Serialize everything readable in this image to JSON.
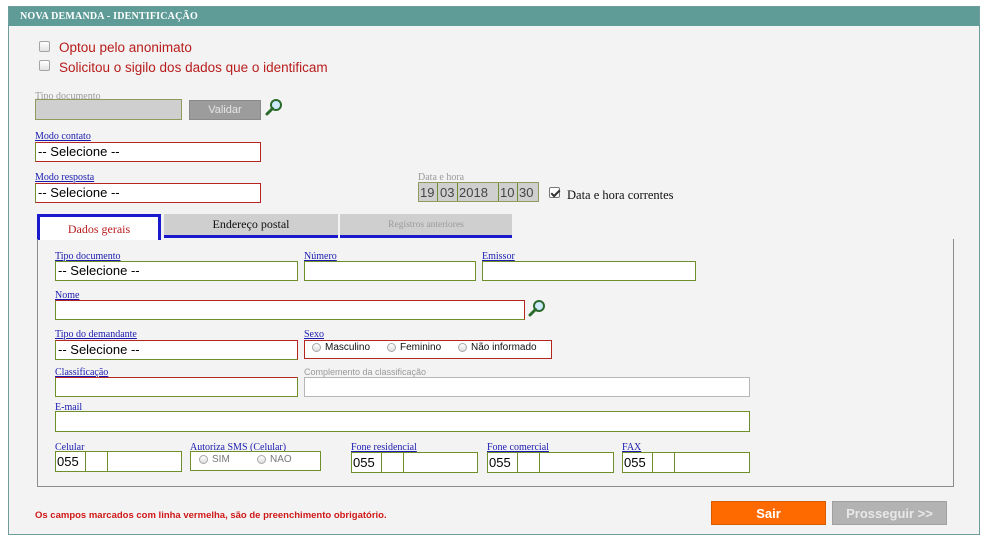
{
  "header": {
    "title": "NOVA DEMANDA - IDENTIFICAÇÃO"
  },
  "options": {
    "anonimato": "Optou pelo anonimato",
    "sigilo": "Solicitou o sigilo dos dados que o identificam"
  },
  "tipo_documento_top": {
    "label": "Tipo documento",
    "value": "",
    "validar_label": "Validar"
  },
  "modo_contato": {
    "label": "Modo contato",
    "value": "-- Selecione --"
  },
  "modo_resposta": {
    "label": "Modo resposta",
    "value": "-- Selecione --"
  },
  "data_hora": {
    "label": "Data e hora",
    "day": "19",
    "month": "03",
    "year": "2018",
    "hour": "10",
    "minute": "30",
    "correntes_label": "Data e hora correntes",
    "correntes_checked": true
  },
  "tabs": [
    {
      "label": "Dados gerais",
      "active": true
    },
    {
      "label": "Endereço postal",
      "active": false
    },
    {
      "label": "Registros anteriores",
      "active": false,
      "disabled": true
    }
  ],
  "form": {
    "tipo_documento": {
      "label": "Tipo documento",
      "value": "-- Selecione --"
    },
    "numero": {
      "label": "Número",
      "value": ""
    },
    "emissor": {
      "label": "Emissor",
      "value": ""
    },
    "nome": {
      "label": "Nome",
      "value": ""
    },
    "tipo_demandante": {
      "label": "Tipo do demandante",
      "value": "-- Selecione --"
    },
    "sexo": {
      "label": "Sexo",
      "options": [
        "Masculino",
        "Feminino",
        "Não informado"
      ]
    },
    "classificacao": {
      "label": "Classificação",
      "value": ""
    },
    "complemento": {
      "label": "Complemento da classificação",
      "value": ""
    },
    "email": {
      "label": "E-mail",
      "value": ""
    },
    "celular": {
      "label": "Celular",
      "ddi": "055"
    },
    "autoriza_sms": {
      "label": "Autoriza SMS (Celular)",
      "options": [
        "SIM",
        "NAO"
      ]
    },
    "fone_residencial": {
      "label": "Fone residencial",
      "ddi": "055"
    },
    "fone_comercial": {
      "label": "Fone comercial",
      "ddi": "055"
    },
    "fax": {
      "label": "FAX",
      "ddi": "055"
    }
  },
  "footer": {
    "note": "Os campos marcados com linha vermelha, são de preenchimento obrigatório.",
    "sair_label": "Sair",
    "prosseguir_label": "Prosseguir >>"
  },
  "colors": {
    "header_bg": "#5f9c98",
    "sair_bg": "#ff6a00",
    "prosseguir_bg": "#b3b3b3",
    "required_line": "#b6251f",
    "tab_active_border": "#1a1acc"
  }
}
